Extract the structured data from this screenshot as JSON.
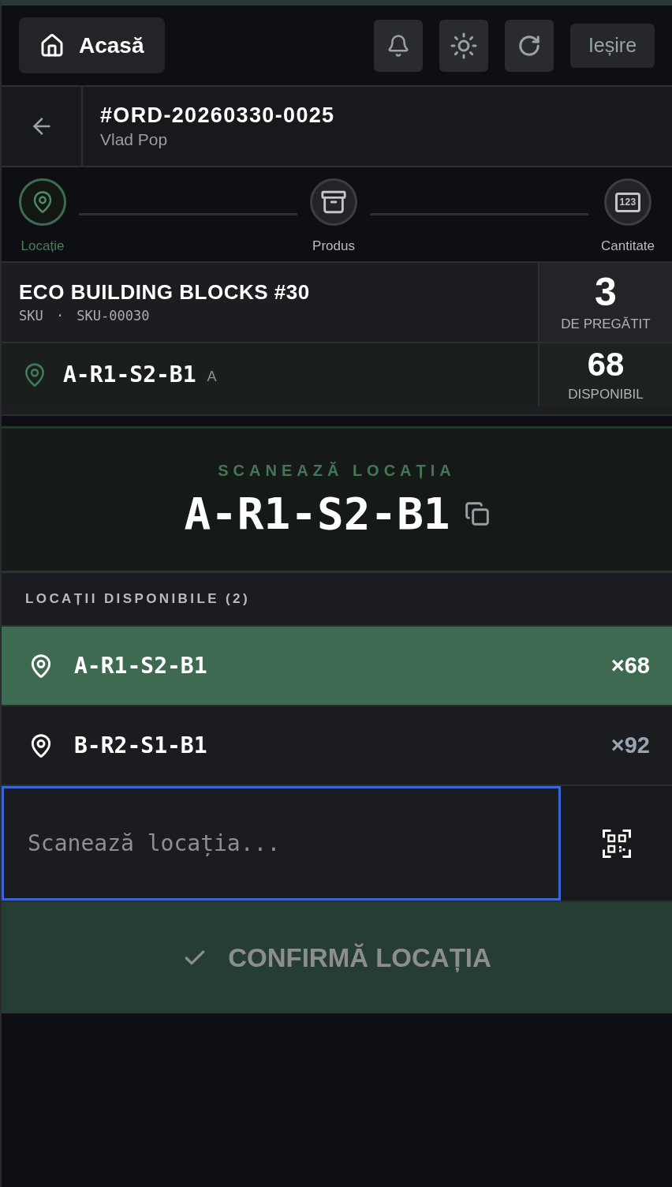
{
  "header": {
    "home_button": {
      "label": "Acasă"
    },
    "logout_button": {
      "label": "Ieșire"
    }
  },
  "order": {
    "number": "#ORD-20260330-0025",
    "customer": "Vlad Pop"
  },
  "stepper": {
    "steps": [
      {
        "label": "Locație",
        "kind": "location",
        "selected": true
      },
      {
        "label": "Produs",
        "kind": "product",
        "selected": false
      },
      {
        "label": "Cantitate",
        "kind": "quantity",
        "icon_text": "123",
        "selected": false
      }
    ]
  },
  "product": {
    "name": "ECO BUILDING BLOCKS #30",
    "sku_line": "SKU · SKU-00030",
    "to_prepare": "3",
    "to_prepare_label": "DE PREGĂTIT"
  },
  "location": {
    "code": "A-R1-S2-B1",
    "zone": "A",
    "available": "68",
    "available_label": "DISPONIBIL"
  },
  "scan_target": {
    "label": "SCANEAZĂ LOCAȚIA",
    "code": "A-R1-S2-B1"
  },
  "available_locations": {
    "title": "LOCAȚII DISPONIBILE (2)",
    "items": [
      {
        "code": "A-R1-S2-B1",
        "quantity": "×68",
        "selected": true
      },
      {
        "code": "B-R2-S1-B1",
        "quantity": "×92",
        "selected": false
      }
    ]
  },
  "scan_input": {
    "placeholder": "Scanează locația...",
    "focused": true
  },
  "confirm_button": {
    "label": "CONFIRMĂ LOCAȚIA",
    "disabled": true
  }
}
